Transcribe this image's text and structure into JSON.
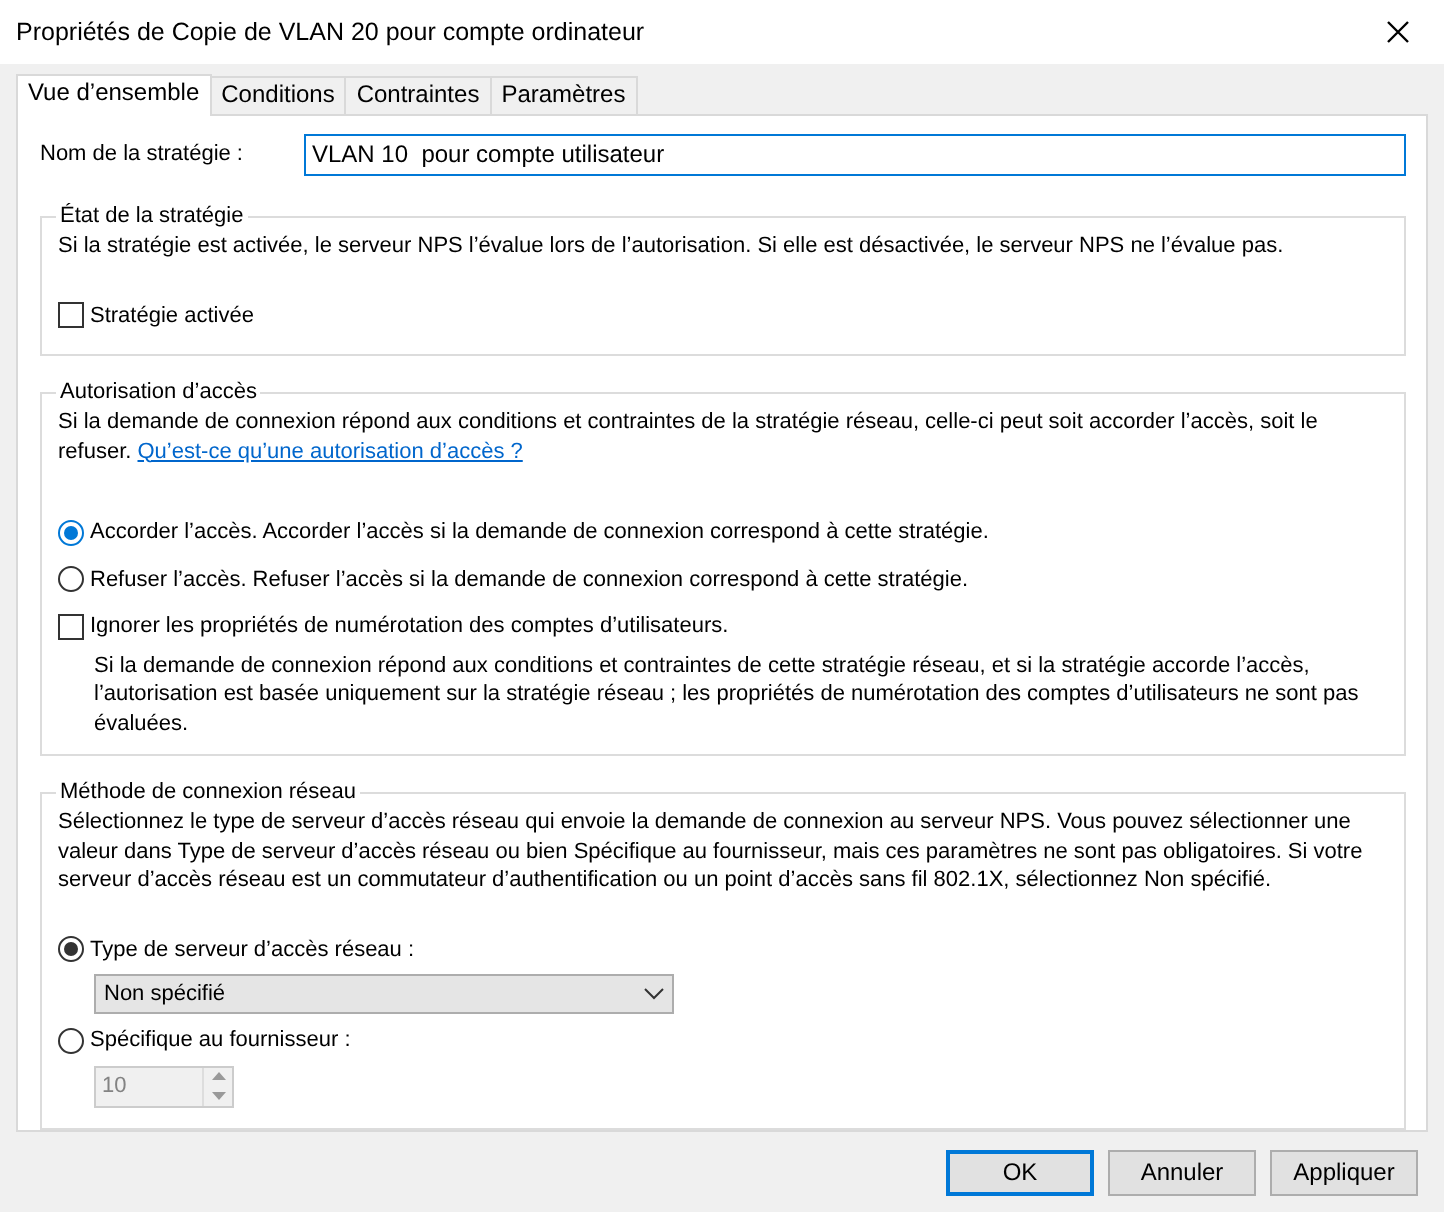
{
  "window": {
    "title": "Propriétés de Copie de VLAN 20 pour compte ordinateur"
  },
  "tabs": [
    {
      "label": "Vue d’ensemble",
      "selected": true
    },
    {
      "label": "Conditions",
      "selected": false
    },
    {
      "label": "Contraintes",
      "selected": false
    },
    {
      "label": "Paramètres",
      "selected": false
    }
  ],
  "policy_name": {
    "label": "Nom de la stratégie :",
    "value": "VLAN 10  pour compte utilisateur"
  },
  "policy_state": {
    "title": "État de la stratégie",
    "description": "Si la stratégie est activée, le serveur NPS l’évalue lors de l’autorisation. Si elle est désactivée, le serveur NPS ne l’évalue pas.",
    "enabled": {
      "label": "Stratégie activée",
      "checked": false
    }
  },
  "access_permission": {
    "title": "Autorisation d’accès",
    "description": "Si la demande de connexion répond aux conditions et contraintes de la stratégie réseau, celle-ci peut soit accorder l’accès, soit le refuser.",
    "link": "Qu’est-ce qu’une autorisation d’accès ?",
    "options": [
      {
        "kind": "radio",
        "label": "Accorder l’accès. Accorder l’accès si la demande de connexion correspond à cette stratégie.",
        "selected": true
      },
      {
        "kind": "radio",
        "label": "Refuser l’accès. Refuser l’accès si la demande de connexion correspond à cette stratégie.",
        "selected": false
      },
      {
        "kind": "checkbox",
        "label": "Ignorer les propriétés de numérotation des comptes d’utilisateurs.",
        "checked": false,
        "note": "Si la demande de connexion répond aux conditions et contraintes de cette stratégie réseau, et si la stratégie accorde l’accès, l’autorisation est basée uniquement sur la stratégie réseau ; les propriétés de numérotation des comptes d’utilisateurs ne sont pas évaluées."
      }
    ]
  },
  "connection_method": {
    "title": "Méthode de connexion réseau",
    "description": "Sélectionnez le type de serveur d’accès réseau qui envoie la demande de connexion au serveur NPS. Vous pouvez sélectionner une valeur dans Type de serveur d’accès réseau ou bien Spécifique au fournisseur, mais ces paramètres ne sont pas obligatoires. Si votre serveur d’accès réseau est un commutateur d’authentification ou un point d’accès sans fil 802.1X, sélectionnez Non spécifié.",
    "options": [
      {
        "label": "Type de serveur d’accès réseau :",
        "selected": true,
        "control": {
          "kind": "select",
          "value": "Non spécifié",
          "disabled": false
        }
      },
      {
        "label": "Spécifique au fournisseur :",
        "selected": false,
        "control": {
          "kind": "spinner",
          "value": "10",
          "disabled": true
        }
      }
    ]
  },
  "buttons": [
    {
      "label": "OK",
      "default": true
    },
    {
      "label": "Annuler",
      "default": false
    },
    {
      "label": "Appliquer",
      "default": false
    }
  ]
}
